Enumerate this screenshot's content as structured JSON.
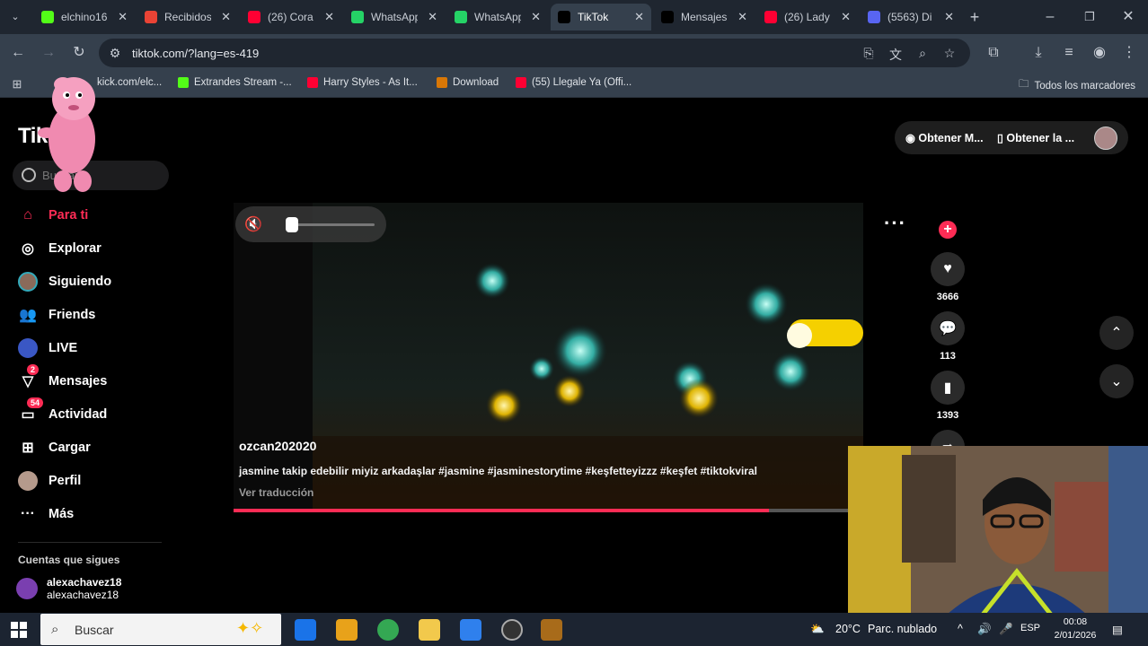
{
  "browser": {
    "tabs": [
      {
        "label": "elchino16",
        "icon": "kick-icon",
        "color": "#53fc18"
      },
      {
        "label": "Recibidos",
        "icon": "gmail-icon",
        "color": "#ea4335"
      },
      {
        "label": "(26) Cora",
        "icon": "youtube-icon",
        "color": "#ff0033"
      },
      {
        "label": "WhatsApp",
        "icon": "whatsapp-icon",
        "color": "#25d366"
      },
      {
        "label": "WhatsApp",
        "icon": "whatsapp-icon",
        "color": "#25d366"
      },
      {
        "label": "TikTok",
        "icon": "tiktok-icon",
        "color": "#000000",
        "active": true
      },
      {
        "label": "Mensajes",
        "icon": "tiktok-icon",
        "color": "#000000"
      },
      {
        "label": "(26) Lady",
        "icon": "youtube-icon",
        "color": "#ff0033"
      },
      {
        "label": "(5563) Di",
        "icon": "discord-icon",
        "color": "#5865f2"
      }
    ],
    "url": "tiktok.com/?lang=es-419",
    "bookmarks": [
      {
        "label": "kick.com/elc...",
        "color": "#53fc18"
      },
      {
        "label": "Extrandes Stream -...",
        "color": "#53fc18"
      },
      {
        "label": "Harry Styles - As It...",
        "color": "#ff0033"
      },
      {
        "label": "Download",
        "color": "#d97706"
      },
      {
        "label": "(55) Llegale Ya (Offi...",
        "color": "#ff0033"
      }
    ],
    "all_bookmarks": "Todos los marcadores"
  },
  "tiktok": {
    "logo": "TikTok",
    "search_placeholder": "Buscar",
    "nav": [
      {
        "label": "Para ti",
        "icon": "home-icon",
        "active": true
      },
      {
        "label": "Explorar",
        "icon": "compass-icon"
      },
      {
        "label": "Siguiendo",
        "icon": "following-avatar-icon"
      },
      {
        "label": "Friends",
        "icon": "friends-icon"
      },
      {
        "label": "LIVE",
        "icon": "live-icon"
      },
      {
        "label": "Mensajes",
        "icon": "messages-icon",
        "badge": "2"
      },
      {
        "label": "Actividad",
        "icon": "activity-icon",
        "badge": "54"
      },
      {
        "label": "Cargar",
        "icon": "upload-icon"
      },
      {
        "label": "Perfil",
        "icon": "profile-icon"
      },
      {
        "label": "Más",
        "icon": "more-icon"
      }
    ],
    "following_title": "Cuentas que sigues",
    "following": [
      {
        "name": "alexachavez18",
        "handle": "alexachavez18"
      }
    ],
    "top_actions": {
      "get_m": "Obtener M...",
      "get_app": "Obtener la ..."
    },
    "video": {
      "author": "ozcan202020",
      "caption": "jasmine takip edebilir miyiz arkadaşlar #jasmine #jasminestorytime #keşfetteyizzz #keşfet #tiktokviral",
      "translate": "Ver traducción",
      "progress": 0.87,
      "volume": 0.0
    },
    "actions": {
      "likes": "3666",
      "comments": "113",
      "saves": "1393"
    }
  },
  "taskbar": {
    "search": "Buscar",
    "weather": "20°C",
    "weather_desc": "Parc. nublado",
    "lang": "ESP",
    "time": "00:08",
    "date": "2/01/2026"
  }
}
